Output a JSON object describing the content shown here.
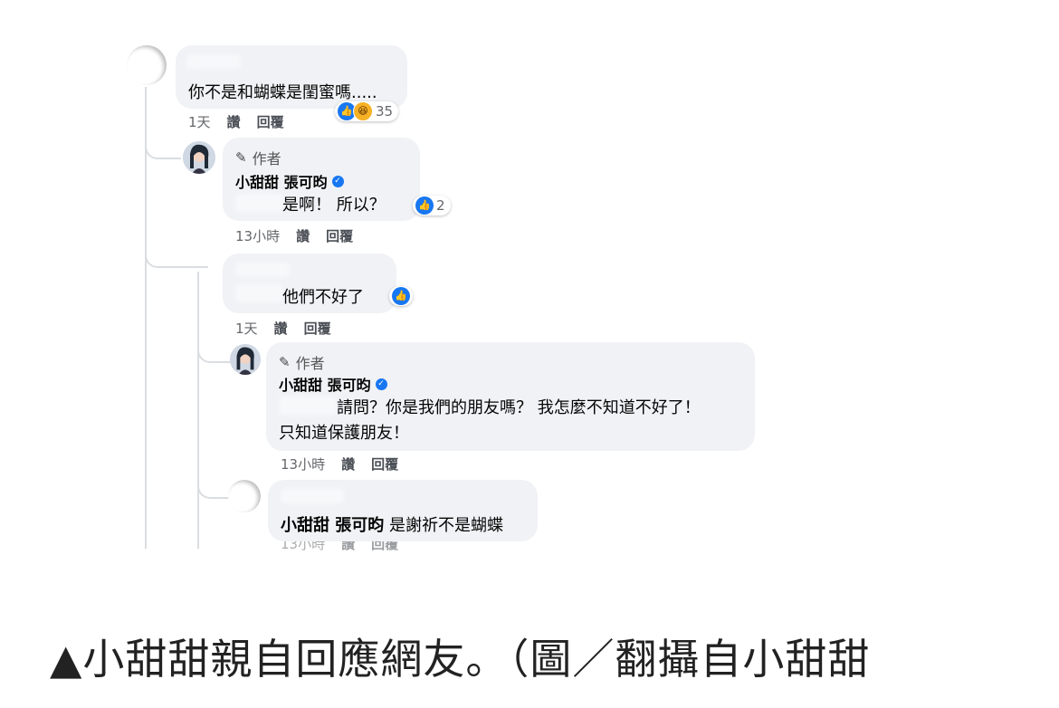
{
  "thread": {
    "comment1": {
      "text": "你不是和蝴蝶是閨蜜嗎.....",
      "time": "1天",
      "like": "讚",
      "reply": "回覆",
      "reaction_count": "35"
    },
    "reply1": {
      "badge": "作者",
      "name": "小甜甜 張可昀",
      "text": "是啊！ 所以？",
      "reaction_count": "2",
      "time": "13小時",
      "like": "讚",
      "reply": "回覆"
    },
    "comment2": {
      "text": "他們不好了",
      "time": "1天",
      "like": "讚",
      "reply": "回覆"
    },
    "reply2": {
      "badge": "作者",
      "name": "小甜甜 張可昀",
      "text_line1": "請問？你是我們的朋友嗎？ 我怎麼不知道不好了！",
      "text_line2": "只知道保護朋友！",
      "time": "13小時",
      "like": "讚",
      "reply": "回覆"
    },
    "comment3": {
      "mention": "小甜甜 張可昀",
      "text": "是謝祈不是蝴蝶"
    }
  },
  "caption": "▲小甜甜親自回應網友。（圖／翻攝自小甜甜"
}
